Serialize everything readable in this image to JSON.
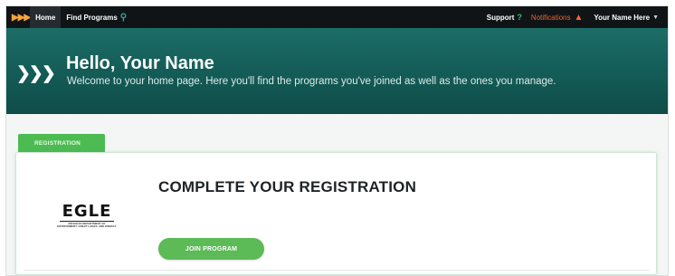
{
  "topnav": {
    "brand_icon": "triple-chevron-icon",
    "items": [
      {
        "label": "Home",
        "active": true
      },
      {
        "label": "Find Programs"
      }
    ],
    "search_icon": "search-icon",
    "support_label": "Support",
    "support_icon": "question-icon",
    "notifications_label": "Notifications",
    "notifications_icon": "bell-icon",
    "user_label": "Your Name Here",
    "user_caret_icon": "chevron-down-icon"
  },
  "hero": {
    "title": "Hello, Your Name",
    "subtitle": "Welcome to your home page. Here you'll find the programs you've joined as well as the ones you manage."
  },
  "registration": {
    "tab_label": "REGISTRATION",
    "logo_text": "EGLE",
    "logo_subtext_line1": "MICHIGAN DEPARTMENT OF",
    "logo_subtext_line2": "ENVIRONMENT, GREAT LAKES, AND ENERGY",
    "heading": "COMPLETE YOUR REGISTRATION",
    "button_label": "JOIN PROGRAM"
  },
  "colors": {
    "nav_bg": "#111417",
    "brand_orange": "#f3a43b",
    "notifications_orange": "#e9662c",
    "hero_teal": "#155e59",
    "accent_green": "#4cbb52"
  }
}
